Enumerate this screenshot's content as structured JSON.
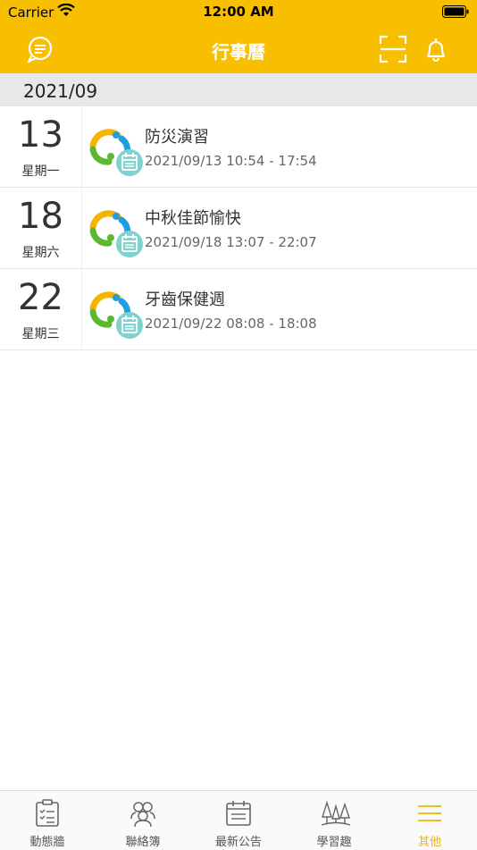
{
  "status_bar": {
    "carrier": "Carrier",
    "time": "12:00 AM"
  },
  "nav": {
    "title": "行事曆"
  },
  "month": "2021/09",
  "events": [
    {
      "day": "13",
      "weekday": "星期一",
      "title": "防災演習",
      "time": "2021/09/13 10:54 - 17:54"
    },
    {
      "day": "18",
      "weekday": "星期六",
      "title": "中秋佳節愉快",
      "time": "2021/09/18 13:07 - 22:07"
    },
    {
      "day": "22",
      "weekday": "星期三",
      "title": "牙齒保健週",
      "time": "2021/09/22 08:08 - 18:08"
    }
  ],
  "tabs": [
    {
      "label": "動態牆",
      "icon": "clipboard-icon"
    },
    {
      "label": "聯絡簿",
      "icon": "people-icon"
    },
    {
      "label": "最新公告",
      "icon": "calendar-icon"
    },
    {
      "label": "學習趣",
      "icon": "trees-icon"
    },
    {
      "label": "其他",
      "icon": "menu-icon",
      "active": true
    }
  ],
  "colors": {
    "brand": "#f7bf00",
    "active_tab": "#f0b400",
    "calendar_badge": "#7fd3cf"
  }
}
